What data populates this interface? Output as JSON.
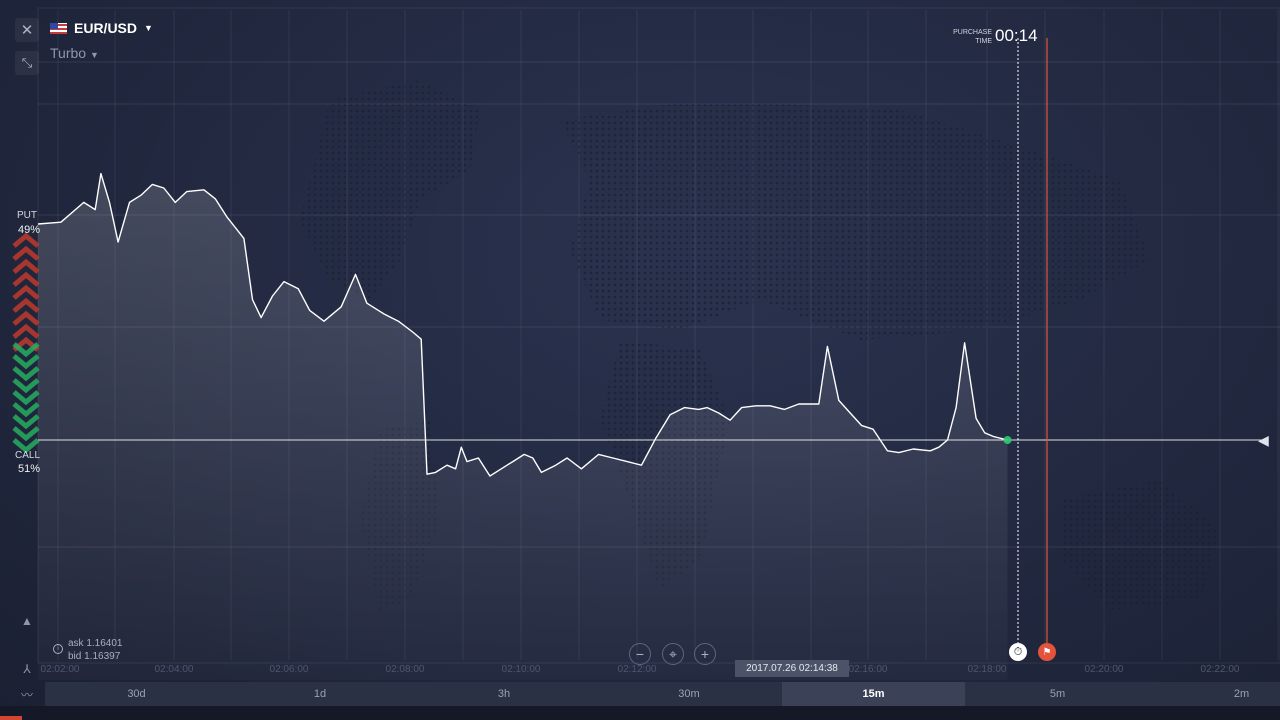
{
  "asset": {
    "name": "EUR/USD",
    "mode": "Turbo"
  },
  "sentiment": {
    "put_label": "PUT",
    "put_pct": "49%",
    "call_label": "CALL",
    "call_pct": "51%"
  },
  "purchase": {
    "label_line1": "PURCHASE",
    "label_line2": "TIME",
    "value": "00:14"
  },
  "quotes": {
    "ask": "ask 1.16401",
    "bid": "bid 1.16397"
  },
  "current_datetime": "2017.07.26 02:14:38",
  "time_axis": [
    "02:02:00",
    "02:04:00",
    "02:06:00",
    "02:08:00",
    "02:10:00",
    "02:12:00",
    "02:16:00",
    "02:18:00",
    "02:20:00",
    "02:22:00"
  ],
  "zoom": {
    "minus": "−",
    "center": "⌖",
    "plus": "+"
  },
  "periods": [
    {
      "label": "30d",
      "active": false
    },
    {
      "label": "1d",
      "active": false
    },
    {
      "label": "3h",
      "active": false
    },
    {
      "label": "30m",
      "active": false
    },
    {
      "label": "15m",
      "active": true
    },
    {
      "label": "5m",
      "active": false
    },
    {
      "label": "2m",
      "active": false
    }
  ],
  "colors": {
    "line": "#ffffff",
    "expiry_line": "#e4533a",
    "put": "#c0392b",
    "call": "#27ae60",
    "current_point": "#2ecc71"
  },
  "icons": {
    "close": "close-icon",
    "collapse": "collapse-arrows-icon",
    "flag": "us-eu-flag-icon",
    "dropdown": "caret-down-icon",
    "timer": "stopwatch-icon",
    "finish": "finish-flag-icon",
    "info": "info-icon",
    "area_chart": "area-chart-icon",
    "indicator": "indicator-icon",
    "line_chart": "line-chart-icon"
  },
  "chart_data": {
    "type": "line",
    "series": [
      {
        "points": [
          [
            0,
            6.0
          ],
          [
            0.8,
            6.05
          ],
          [
            1.6,
            6.6
          ],
          [
            2.0,
            6.4
          ],
          [
            2.2,
            7.4
          ],
          [
            2.5,
            6.6
          ],
          [
            2.8,
            5.5
          ],
          [
            3.2,
            6.6
          ],
          [
            3.6,
            6.8
          ],
          [
            4.0,
            7.1
          ],
          [
            4.4,
            7.0
          ],
          [
            4.8,
            6.6
          ],
          [
            5.2,
            6.9
          ],
          [
            5.8,
            6.95
          ],
          [
            6.2,
            6.7
          ],
          [
            6.6,
            6.2
          ],
          [
            7.0,
            5.8
          ],
          [
            7.2,
            5.6
          ],
          [
            7.5,
            3.9
          ],
          [
            7.8,
            3.4
          ],
          [
            8.2,
            4.0
          ],
          [
            8.6,
            4.4
          ],
          [
            9.1,
            4.2
          ],
          [
            9.5,
            3.6
          ],
          [
            10.0,
            3.3
          ],
          [
            10.6,
            3.7
          ],
          [
            11.1,
            4.6
          ],
          [
            11.5,
            3.8
          ],
          [
            12.1,
            3.5
          ],
          [
            12.6,
            3.3
          ],
          [
            13.1,
            3.0
          ],
          [
            13.4,
            2.8
          ],
          [
            13.6,
            -0.95
          ],
          [
            13.9,
            -0.9
          ],
          [
            14.3,
            -0.7
          ],
          [
            14.6,
            -0.8
          ],
          [
            14.8,
            -0.2
          ],
          [
            15.0,
            -0.6
          ],
          [
            15.4,
            -0.5
          ],
          [
            15.8,
            -1.0
          ],
          [
            16.2,
            -0.8
          ],
          [
            16.6,
            -0.6
          ],
          [
            17.0,
            -0.4
          ],
          [
            17.3,
            -0.5
          ],
          [
            17.6,
            -0.9
          ],
          [
            18.1,
            -0.7
          ],
          [
            18.5,
            -0.5
          ],
          [
            19.0,
            -0.8
          ],
          [
            19.6,
            -0.4
          ],
          [
            20.1,
            -0.5
          ],
          [
            20.6,
            -0.6
          ],
          [
            21.1,
            -0.7
          ],
          [
            21.6,
            0.05
          ],
          [
            22.1,
            0.7
          ],
          [
            22.6,
            0.9
          ],
          [
            23.1,
            0.85
          ],
          [
            23.4,
            0.9
          ],
          [
            23.8,
            0.75
          ],
          [
            24.2,
            0.55
          ],
          [
            24.6,
            0.9
          ],
          [
            25.1,
            0.95
          ],
          [
            25.6,
            0.95
          ],
          [
            26.1,
            0.85
          ],
          [
            26.6,
            1.0
          ],
          [
            27.3,
            1.0
          ],
          [
            27.6,
            2.6
          ],
          [
            28.0,
            1.1
          ],
          [
            28.4,
            0.75
          ],
          [
            28.8,
            0.4
          ],
          [
            29.2,
            0.3
          ],
          [
            29.7,
            -0.3
          ],
          [
            30.1,
            -0.35
          ],
          [
            30.6,
            -0.25
          ],
          [
            31.2,
            -0.3
          ],
          [
            31.5,
            -0.2
          ],
          [
            31.8,
            0.0
          ],
          [
            32.1,
            0.9
          ],
          [
            32.4,
            2.7
          ],
          [
            32.8,
            0.6
          ],
          [
            33.1,
            0.2
          ],
          [
            33.4,
            0.1
          ],
          [
            33.9,
            0.0
          ]
        ]
      }
    ],
    "xlim": [
      0,
      38
    ],
    "xticks": [
      "02:02:00",
      "02:04:00",
      "02:06:00",
      "02:08:00",
      "02:10:00",
      "02:12:00",
      "02:16:00",
      "02:18:00",
      "02:20:00",
      "02:22:00"
    ],
    "grid": true,
    "purchase_marker": "02:18:30",
    "expiry_marker": "02:19:00"
  }
}
